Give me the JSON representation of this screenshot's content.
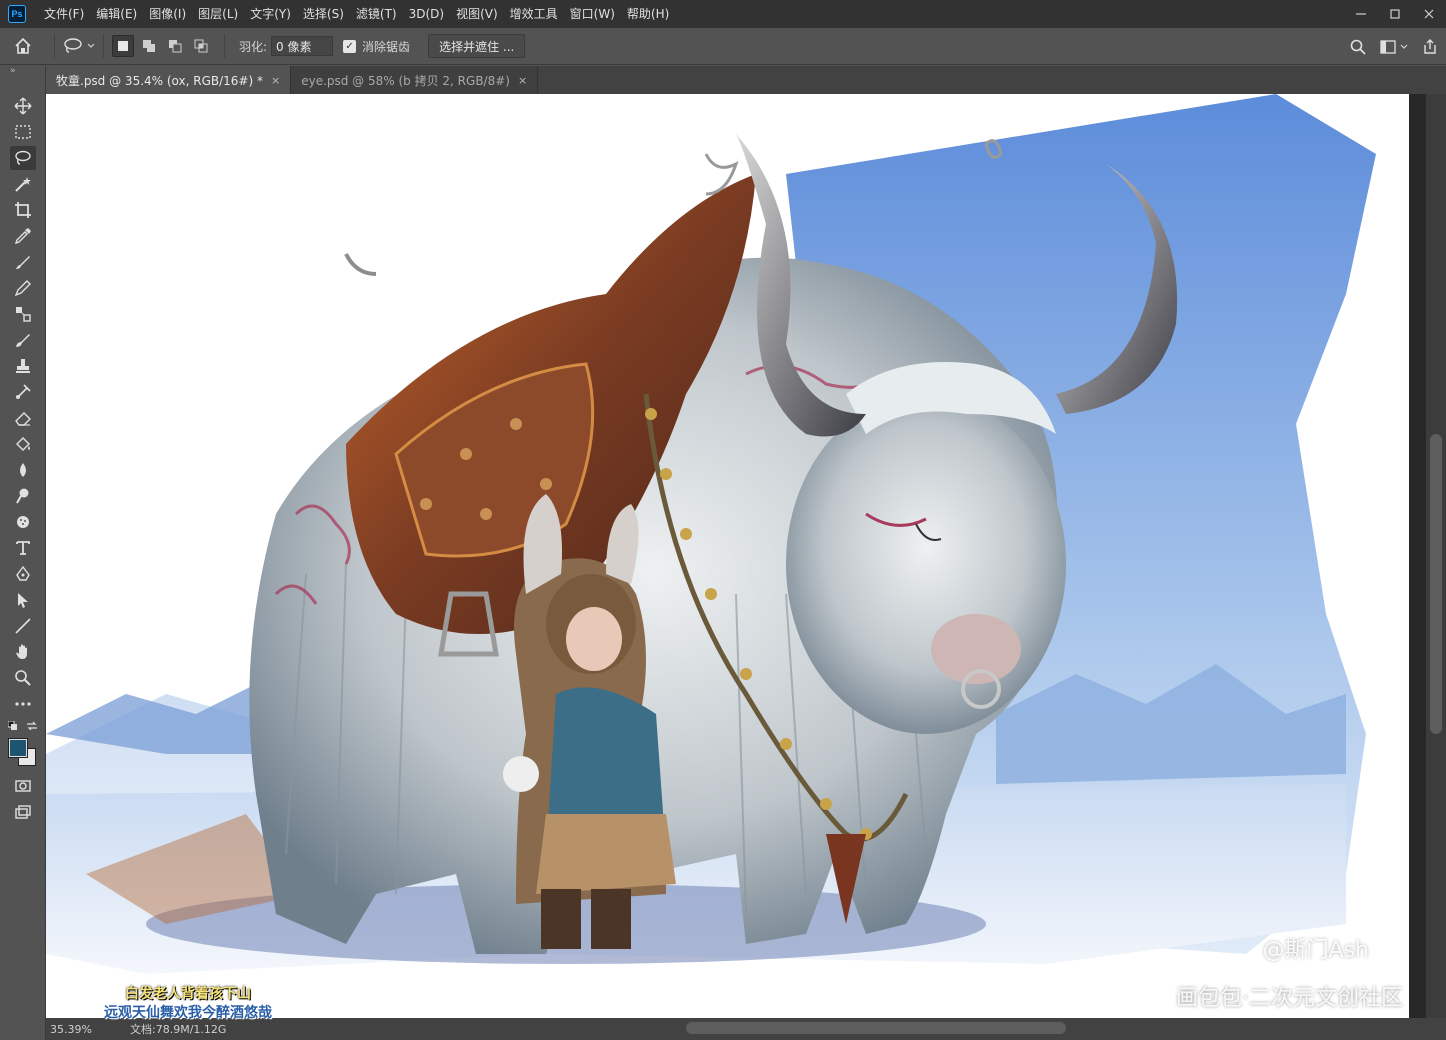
{
  "app": {
    "logo_text": "Ps",
    "menu": [
      "文件(F)",
      "编辑(E)",
      "图像(I)",
      "图层(L)",
      "文字(Y)",
      "选择(S)",
      "滤镜(T)",
      "3D(D)",
      "视图(V)",
      "增效工具",
      "窗口(W)",
      "帮助(H)"
    ],
    "window_controls": [
      "minimize-icon",
      "restore-icon",
      "close-icon"
    ]
  },
  "options_bar": {
    "feather_label": "羽化:",
    "feather_value": "0 像素",
    "antialias_label": "消除锯齿",
    "antialias_checked": true,
    "select_mask_label": "选择并遮住 ..."
  },
  "tools": [
    "move-tool-icon",
    "marquee-tool-icon",
    "lasso-tool-icon",
    "magic-wand-tool-icon",
    "crop-tool-icon",
    "eyedropper-tool-icon",
    "healing-brush-tool-icon",
    "brush-tool-icon",
    "clone-stamp-tool-icon",
    "history-brush-tool-icon",
    "eraser-tool-icon",
    "paint-bucket-tool-icon",
    "blur-tool-icon",
    "dodge-tool-icon",
    "sponge-tool-icon",
    "type-tool-icon",
    "pen-tool-icon",
    "path-selection-tool-icon",
    "line-tool-icon",
    "hand-tool-icon",
    "zoom-tool-icon",
    "more-tools-icon"
  ],
  "colors": {
    "foreground": "#1d5470",
    "background": "#e8e8e8"
  },
  "tabs": [
    {
      "label": "牧童.psd @ 35.4% (ox, RGB/16#) *",
      "active": true
    },
    {
      "label": "eye.psd @ 58% (b 拷贝 2, RGB/8#)",
      "active": false
    }
  ],
  "canvas": {
    "watermark_handle": "@斯门Ash",
    "watermark_site": "画包包·二次元文创社区"
  },
  "status": {
    "zoom": "35.39%",
    "doc_size": "文档:78.9M/1.12G"
  },
  "caption": {
    "line1": "白发老人背着孩下山",
    "line2": "远观天仙舞欢我今醉酒悠哉"
  }
}
